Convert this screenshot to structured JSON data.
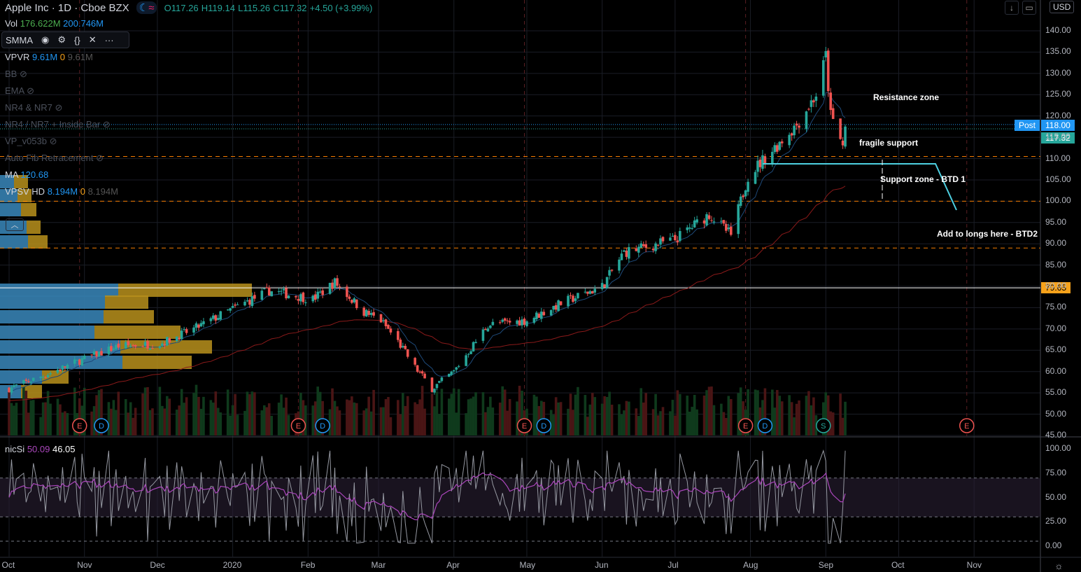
{
  "header": {
    "symbol": "Apple Inc",
    "interval": "1D",
    "exchange": "Cboe BZX",
    "open": "O117.26",
    "high": "H119.14",
    "low": "L115.26",
    "close": "C117.32",
    "change": "+4.50 (+3.99%)"
  },
  "volume_legend": {
    "label": "Vol",
    "v1": "176.622M",
    "v2": "200.746M"
  },
  "smma_toolbar": {
    "label": "SMMA"
  },
  "indicators": [
    {
      "name": "VPVR",
      "v1": "9.61M",
      "v2": "0",
      "v3": "9.61M"
    },
    {
      "name": "BB"
    },
    {
      "name": "EMA"
    },
    {
      "name": "NR4 & NR7"
    },
    {
      "name": "NR4 / NR7 + Inside Bar"
    },
    {
      "name": "VP_v053b"
    },
    {
      "name": "Auto Fib Retracement"
    },
    {
      "name": "MA",
      "v1": "120.68"
    },
    {
      "name": "VPSV HD",
      "v1": "8.194M",
      "v2": "0",
      "v3": "8.194M"
    }
  ],
  "currency": "USD",
  "price_axis": [
    "140.00",
    "135.00",
    "130.00",
    "125.00",
    "120.00",
    "115.00",
    "110.00",
    "105.00",
    "100.00",
    "95.00",
    "90.00",
    "85.00",
    "80.00",
    "75.00",
    "70.00",
    "65.00",
    "60.00",
    "55.00",
    "50.00",
    "45.00"
  ],
  "price_tags": {
    "post_label": "Post",
    "post": "118.00",
    "last": "117.32",
    "line": "79.65"
  },
  "rsi": {
    "name": "nicSi",
    "v1": "50.09",
    "v2": "46.05",
    "axis": [
      "100.00",
      "75.00",
      "50.00",
      "25.00",
      "0.00"
    ]
  },
  "time_axis": [
    {
      "l": "Oct",
      "d": "2019-10-01"
    },
    {
      "l": "Nov",
      "d": "2019-11-01"
    },
    {
      "l": "Dec",
      "d": "2019-12-01"
    },
    {
      "l": "2020",
      "d": "2020-01-01"
    },
    {
      "l": "Feb",
      "d": "2020-02-01"
    },
    {
      "l": "Mar",
      "d": "2020-03-01"
    },
    {
      "l": "Apr",
      "d": "2020-04-01"
    },
    {
      "l": "May",
      "d": "2020-05-01"
    },
    {
      "l": "Jun",
      "d": "2020-06-01"
    },
    {
      "l": "Jul",
      "d": "2020-07-01"
    },
    {
      "l": "Aug",
      "d": "2020-08-01"
    },
    {
      "l": "Sep",
      "d": "2020-09-01"
    },
    {
      "l": "Oct",
      "d": "2020-10-01"
    },
    {
      "l": "Nov",
      "d": "2020-11-01"
    }
  ],
  "annotations": {
    "resistance": "Resistance zone",
    "fragile": "fragile support",
    "support": "Support zone - BTD 1",
    "add": "Add to longs here - BTD2"
  },
  "events": [
    {
      "t": "E",
      "d": "2019-10-30"
    },
    {
      "t": "D",
      "d": "2019-11-08"
    },
    {
      "t": "E",
      "d": "2020-01-28"
    },
    {
      "t": "D",
      "d": "2020-02-07"
    },
    {
      "t": "E",
      "d": "2020-04-30"
    },
    {
      "t": "D",
      "d": "2020-05-08"
    },
    {
      "t": "E",
      "d": "2020-07-30"
    },
    {
      "t": "D",
      "d": "2020-08-07"
    },
    {
      "t": "S",
      "d": "2020-08-31"
    },
    {
      "t": "E",
      "d": "2020-10-29"
    }
  ],
  "colors": {
    "up": "#26a69a",
    "down": "#ef5350",
    "accent": "#2196f3",
    "fib": "#f57c00",
    "trend": "#4dd0e1"
  },
  "chart_data": {
    "type": "candlestick",
    "anchors": [
      [
        "2019-10-01",
        56
      ],
      [
        "2019-10-15",
        59
      ],
      [
        "2019-11-01",
        63
      ],
      [
        "2019-11-15",
        66
      ],
      [
        "2019-12-02",
        66.5
      ],
      [
        "2019-12-16",
        70
      ],
      [
        "2020-01-02",
        75
      ],
      [
        "2020-01-16",
        79
      ],
      [
        "2020-02-03",
        77
      ],
      [
        "2020-02-12",
        81
      ],
      [
        "2020-02-24",
        74
      ],
      [
        "2020-03-02",
        72
      ],
      [
        "2020-03-09",
        67
      ],
      [
        "2020-03-16",
        61
      ],
      [
        "2020-03-23",
        56
      ],
      [
        "2020-04-01",
        60
      ],
      [
        "2020-04-15",
        71
      ],
      [
        "2020-05-01",
        72
      ],
      [
        "2020-05-15",
        76
      ],
      [
        "2020-06-01",
        80
      ],
      [
        "2020-06-10",
        88
      ],
      [
        "2020-07-01",
        91
      ],
      [
        "2020-07-15",
        97
      ],
      [
        "2020-07-24",
        92
      ],
      [
        "2020-07-31",
        106
      ],
      [
        "2020-08-10",
        112
      ],
      [
        "2020-08-20",
        118
      ],
      [
        "2020-08-28",
        125
      ],
      [
        "2020-09-01",
        134
      ],
      [
        "2020-09-03",
        120
      ],
      [
        "2020-09-08",
        113
      ],
      [
        "2020-09-09",
        117.32
      ]
    ],
    "fib_levels": [
      110.5,
      100,
      89
    ],
    "hline": 79.65
  }
}
